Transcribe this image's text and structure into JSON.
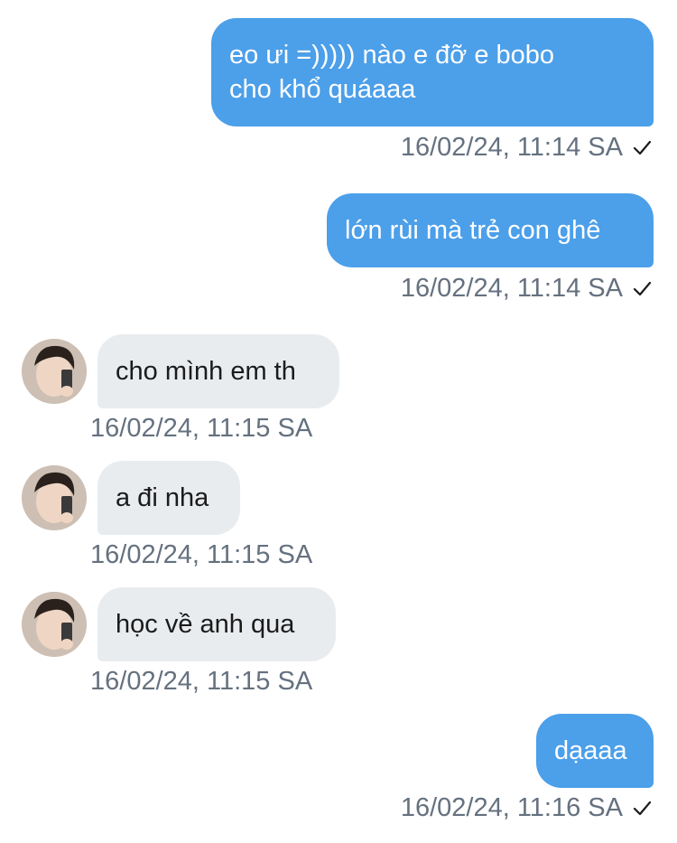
{
  "messages": [
    {
      "direction": "sent",
      "text": "eo ưi =))))) nào e đỡ e bobo\ncho khổ quáaaa",
      "time": "16/02/24, 11:14 SA",
      "read_receipt": "check-icon"
    },
    {
      "direction": "sent",
      "text": "lớn rùi mà trẻ con ghê",
      "time": "16/02/24, 11:14 SA",
      "read_receipt": "check-icon"
    },
    {
      "direction": "received",
      "text": "cho mình em th",
      "time": "16/02/24, 11:15 SA",
      "avatar": "avatar-photo"
    },
    {
      "direction": "received",
      "text": "a đi nha",
      "time": "16/02/24, 11:15 SA",
      "avatar": "avatar-photo"
    },
    {
      "direction": "received",
      "text": "học về anh qua",
      "time": "16/02/24, 11:15 SA",
      "avatar": "avatar-photo"
    },
    {
      "direction": "sent",
      "text": "dạaaa",
      "time": "16/02/24, 11:16 SA",
      "read_receipt": "check-icon"
    }
  ],
  "colors": {
    "sent_bubble": "#4c9fe9",
    "received_bubble": "#e9ecef",
    "timestamp": "#65717f"
  }
}
